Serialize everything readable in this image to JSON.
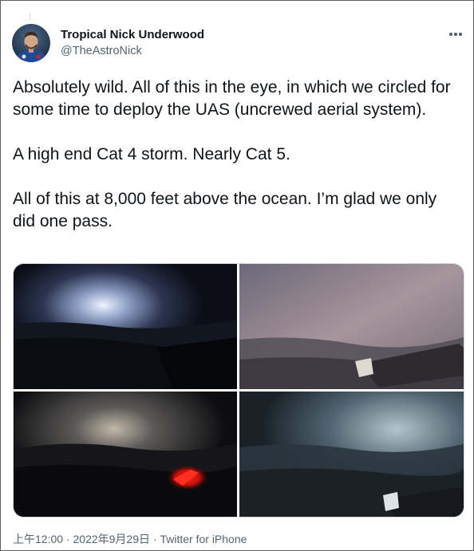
{
  "author": {
    "display_name": "Tropical Nick Underwood",
    "handle": "@TheAstroNick",
    "avatar_icon": "astronaut-portrait-avatar"
  },
  "more_icon": "ellipsis-icon",
  "tweet": {
    "paragraphs": [
      "Absolutely wild. All of this in the eye, in which we circled for some time to deploy the UAS (uncrewed aerial system).",
      "A high end Cat 4 storm. Nearly Cat 5.",
      "All of this at 8,000 feet above the ocean. I’m glad we only did one pass."
    ]
  },
  "media": {
    "photo_count": 4
  },
  "footer": {
    "time": "上午12:00",
    "sep1": " · ",
    "date": "2022年9月29日",
    "sep2": " · ",
    "source": "Twitter for iPhone"
  },
  "colors": {
    "text": "#0f1419",
    "secondary": "#536471"
  }
}
